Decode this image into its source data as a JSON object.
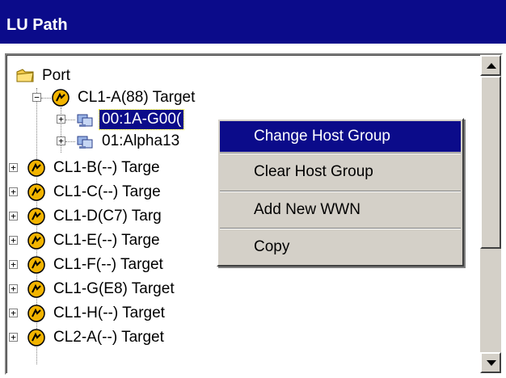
{
  "window": {
    "title": "LU Path"
  },
  "tree": {
    "root": {
      "label": "Port",
      "icon": "folder-icon"
    },
    "nodes": [
      {
        "label": "CL1-A(88) Target",
        "icon": "port-icon",
        "expander": "−",
        "children": [
          {
            "label": "00:1A-G00(",
            "icon": "host-group-icon",
            "expander": "+",
            "selected": true
          },
          {
            "label": "01:Alpha13",
            "icon": "host-group-icon",
            "expander": "+"
          }
        ]
      },
      {
        "label": "CL1-B(--) Targe",
        "icon": "port-icon",
        "expander": "+"
      },
      {
        "label": "CL1-C(--) Targe",
        "icon": "port-icon",
        "expander": "+"
      },
      {
        "label": "CL1-D(C7) Targ",
        "icon": "port-icon",
        "expander": "+"
      },
      {
        "label": "CL1-E(--) Targe",
        "icon": "port-icon",
        "expander": "+"
      },
      {
        "label": "CL1-F(--) Target",
        "icon": "port-icon",
        "expander": "+"
      },
      {
        "label": "CL1-G(E8) Target",
        "icon": "port-icon",
        "expander": "+"
      },
      {
        "label": "CL1-H(--) Target",
        "icon": "port-icon",
        "expander": "+"
      },
      {
        "label": "CL2-A(--) Target",
        "icon": "port-icon",
        "expander": "+"
      }
    ]
  },
  "context_menu": {
    "items": [
      {
        "label": "Change Host Group",
        "active": true
      },
      {
        "label": "Clear Host Group",
        "active": false
      },
      {
        "label": "Add New WWN",
        "active": false
      },
      {
        "label": "Copy",
        "active": false
      }
    ]
  },
  "colors": {
    "title_bg": "#0b0b8a",
    "selection_bg": "#0b0b8a",
    "menu_bg": "#d4d0c8",
    "port_icon_yellow": "#f2b400"
  }
}
